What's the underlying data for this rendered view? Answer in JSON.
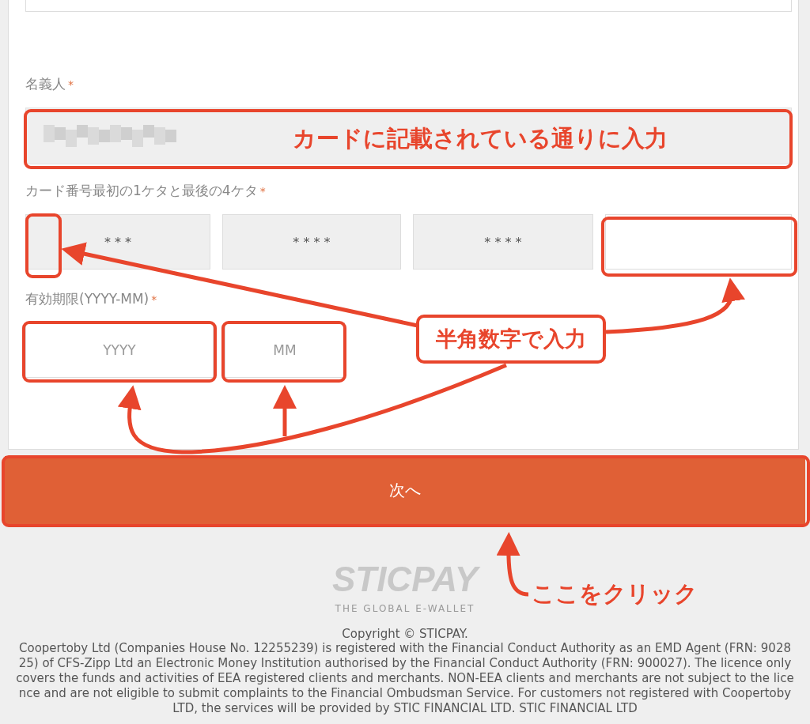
{
  "holder": {
    "label": "名義人",
    "marker": "*"
  },
  "card_number": {
    "label": "カード番号最初の1ケタと最後の4ケタ",
    "marker": "*",
    "fields": [
      {
        "value": "* * *",
        "disabled": true
      },
      {
        "value": "* * * *",
        "disabled": true
      },
      {
        "value": "* * * *",
        "disabled": true
      },
      {
        "disabled": false
      }
    ]
  },
  "expiry": {
    "label": "有効期限(YYYY-MM)",
    "marker": "*",
    "fields": [
      {
        "placeholder": "YYYY"
      },
      {
        "placeholder": "MM"
      }
    ]
  },
  "next_button": {
    "label": "次へ"
  },
  "logo": {
    "name": "STICPAY",
    "tagline": "THE GLOBAL E-WALLET"
  },
  "footer": {
    "copyright": "Copyright © STICPAY.",
    "legal": "Coopertoby Ltd (Companies House No. 12255239) is registered with the Financial Conduct Authority as an EMD Agent (FRN: 902825) of CFS-Zipp Ltd an Electronic Money Institution authorised by the Financial Conduct Authority (FRN: 900027). The licence only covers the funds and activities of EEA registered clients and merchants. NON-EEA clients and merchants are not subject to the licence and are not eligible to submit complaints to the Financial Ombudsman Service. For customers not registered with Coopertoby LTD, the services will be provided by STIC FINANCIAL LTD. STIC FINANCIAL LTD"
  },
  "annotations": [
    {
      "text": "カードに記載されている通りに入力"
    },
    {
      "text": "半角数字で入力"
    },
    {
      "text": "ここをクリック"
    }
  ]
}
